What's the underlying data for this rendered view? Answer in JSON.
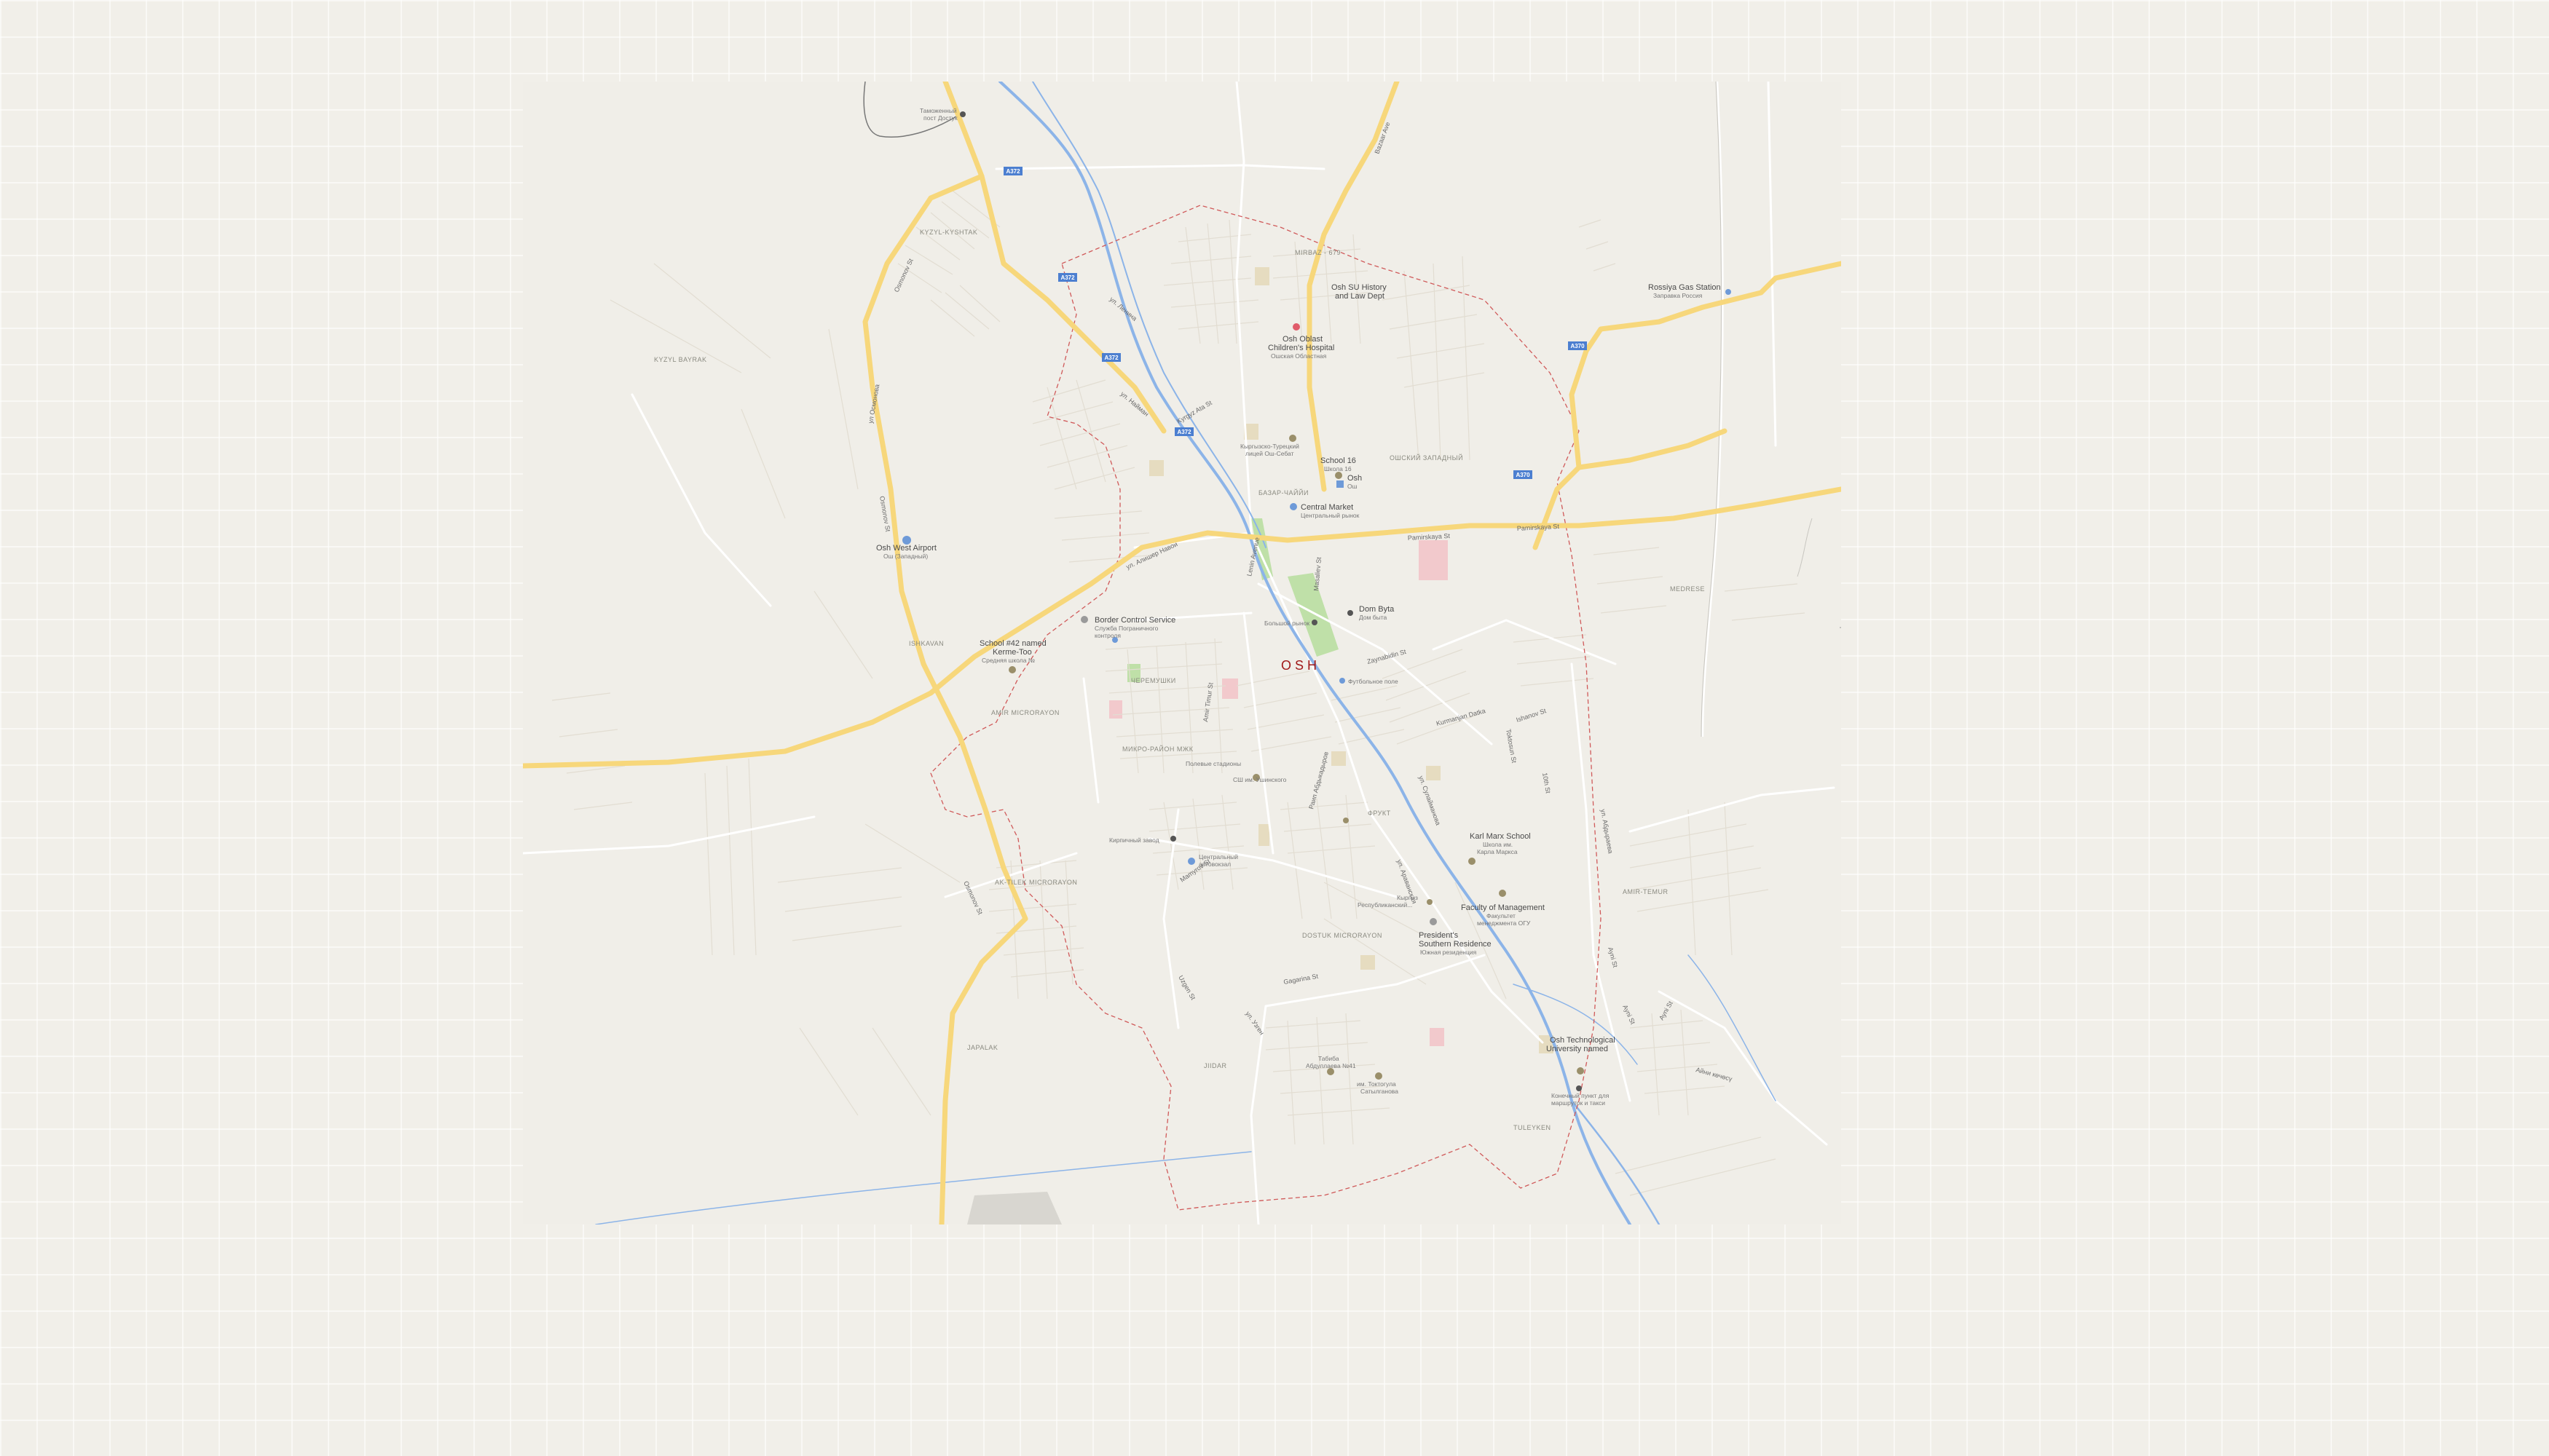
{
  "colors": {
    "background": "#f1efe9",
    "map_land": "#f0eee8",
    "major_road": "#f7d77b",
    "minor_road": "#e2ddd2",
    "river": "#8cb4e8",
    "boundary": "#d05a5a",
    "park": "#bfe0a8",
    "hospital_area": "#f2c9cc",
    "city_label": "#a01818",
    "shield": "#4c7fd0"
  },
  "map": {
    "city_label": "OSH",
    "districts": {
      "kyzyl_kyshtak": "KYZYL-KYSHTAK",
      "kyzyl_bayrak": "KYZYL BAYRAK",
      "mirbaz": "MIRBAZ - 679",
      "osh_west": "ОШСКИЙ ЗАПАДНЫЙ",
      "ishkavan": "ISHKAVAN",
      "amir_mkr": "AMIR MICRORAYON",
      "micro_ra": "МИКРО-РАЙОН МЖК",
      "ak_tilek": "AK-TILEK MICRORAYON",
      "dostuk": "DOSTUK MICRORAYON",
      "japalak": "JAPALAK",
      "jiidar": "JIIDAR",
      "tuleyken": "TULEYKEN",
      "amir_temur": "AMIR-TEMUR",
      "medrese": "MEDRESE",
      "cheremushki": "ЧЕРЕМУШКИ",
      "bazar": "БАЗАР-ЧАЙЙИ",
      "fruct": "ФРУКТ"
    },
    "pois": {
      "airport": {
        "name": "Osh West Airport",
        "sub": "Ош (Западный)"
      },
      "history_dept": {
        "name": "Osh SU History",
        "name2": "and Law Dept"
      },
      "hospital": {
        "name": "Osh Oblast",
        "name2": "Children's Hospital",
        "sub": "Ошская Областная"
      },
      "school16": {
        "name": "School 16",
        "sub": "Школа 16"
      },
      "central_market": {
        "name": "Central Market",
        "sub": "Центральный рынок"
      },
      "osh_hotel": {
        "name": "Osh",
        "sub": "Ош"
      },
      "border": {
        "name": "Border Control Service",
        "sub": "Служба Пограничного",
        "sub2": "контроля"
      },
      "school42": {
        "name": "School #42 named",
        "name2": "Kerme-Too",
        "sub": "Средняя школа №"
      },
      "dom_byta": {
        "name": "Dom Byta",
        "sub": "Дом быта"
      },
      "karl_marx": {
        "name": "Karl Marx School",
        "sub": "Школа им.",
        "sub2": "Карла Маркса"
      },
      "faculty": {
        "name": "Faculty of Management",
        "sub": "Факультет",
        "sub2": "менеджмента ОГУ"
      },
      "president": {
        "name": "President's",
        "name2": "Southern Residence",
        "sub": "Южная резиденция"
      },
      "tech_univ": {
        "name": "Osh Technological",
        "name2": "University named"
      },
      "rossiya_gas": {
        "name": "Rossiya Gas Station",
        "sub": "Заправка Россия"
      },
      "customs": {
        "name": "Таможенный",
        "name2": "пост Достук"
      },
      "hotel_bus": {
        "name": "Конечный пункт для",
        "name2": "маршруток и такси"
      },
      "stadium": {
        "name": "Кыргызско-Турецкий",
        "name2": "лицей Ош-Себат"
      },
      "market_fish": {
        "name": "Большой рынок"
      },
      "football": {
        "name": "Футбольное поле"
      },
      "brick": {
        "name": "Кирпичный завод"
      },
      "central_bus": {
        "name": "Центральный",
        "name2": "автовокзал"
      },
      "rep_clinic": {
        "name": "Кыргыз",
        "name2": "Республиканский..."
      },
      "park_school": {
        "name": "СШ им. Ушинского"
      },
      "sports": {
        "name": "Полевые стадионы"
      },
      "tabiba": {
        "name": "Табиба",
        "name2": "Абдуллаева №41"
      },
      "toktogul": {
        "name": "им. Токтогула",
        "name2": "Сатылганова"
      }
    },
    "streets": {
      "osmonov_a": "Osmonov St",
      "osmonov_b": "ул Осмонова",
      "osmonov_c": "Osmonov St",
      "osmonov_d": "Osmonov St",
      "pamirskaya": "Pamirskaya St",
      "pamirskaya2": "Pamirskaya St",
      "lenin": "Lenin Avenue",
      "masaliev": "Masaliev St",
      "zaynabidin": "Zaynabidin St",
      "kurmanjan": "Kurmanjan Datka",
      "ishanov": "Ishanov St",
      "alisher": "ул. Алишер Навои",
      "amir_timur": "Amir Timur St",
      "mamyrov": "Mamyrov St",
      "uzgen": "Uzgen St",
      "uzgen2": "ул. Узген",
      "gagarin": "Gagarina St",
      "ayni": "Ayni St",
      "ayni2": "Ayni St",
      "ayni3": "Ayni St",
      "abdyraev": "ул. Абдыраева",
      "toktosun": "Toktosun St",
      "sulaymanov": "ул. Сулайманова",
      "10th": "10th St",
      "aitmatov": "Айни көчөсү",
      "rayp": "Раип Абдыкадыров",
      "kyrgyz_ata": "Kyrgyz Ata St",
      "bazar_ave": "Bazaar Ave",
      "lenin_st": "ул. Ленина",
      "nayman": "ул. Найман",
      "aravan": "ул. Араванская"
    },
    "shields": {
      "s1": "A372",
      "s2": "A372",
      "s3": "A372",
      "s4": "A372",
      "s5": "A370",
      "s6": "A370"
    }
  }
}
